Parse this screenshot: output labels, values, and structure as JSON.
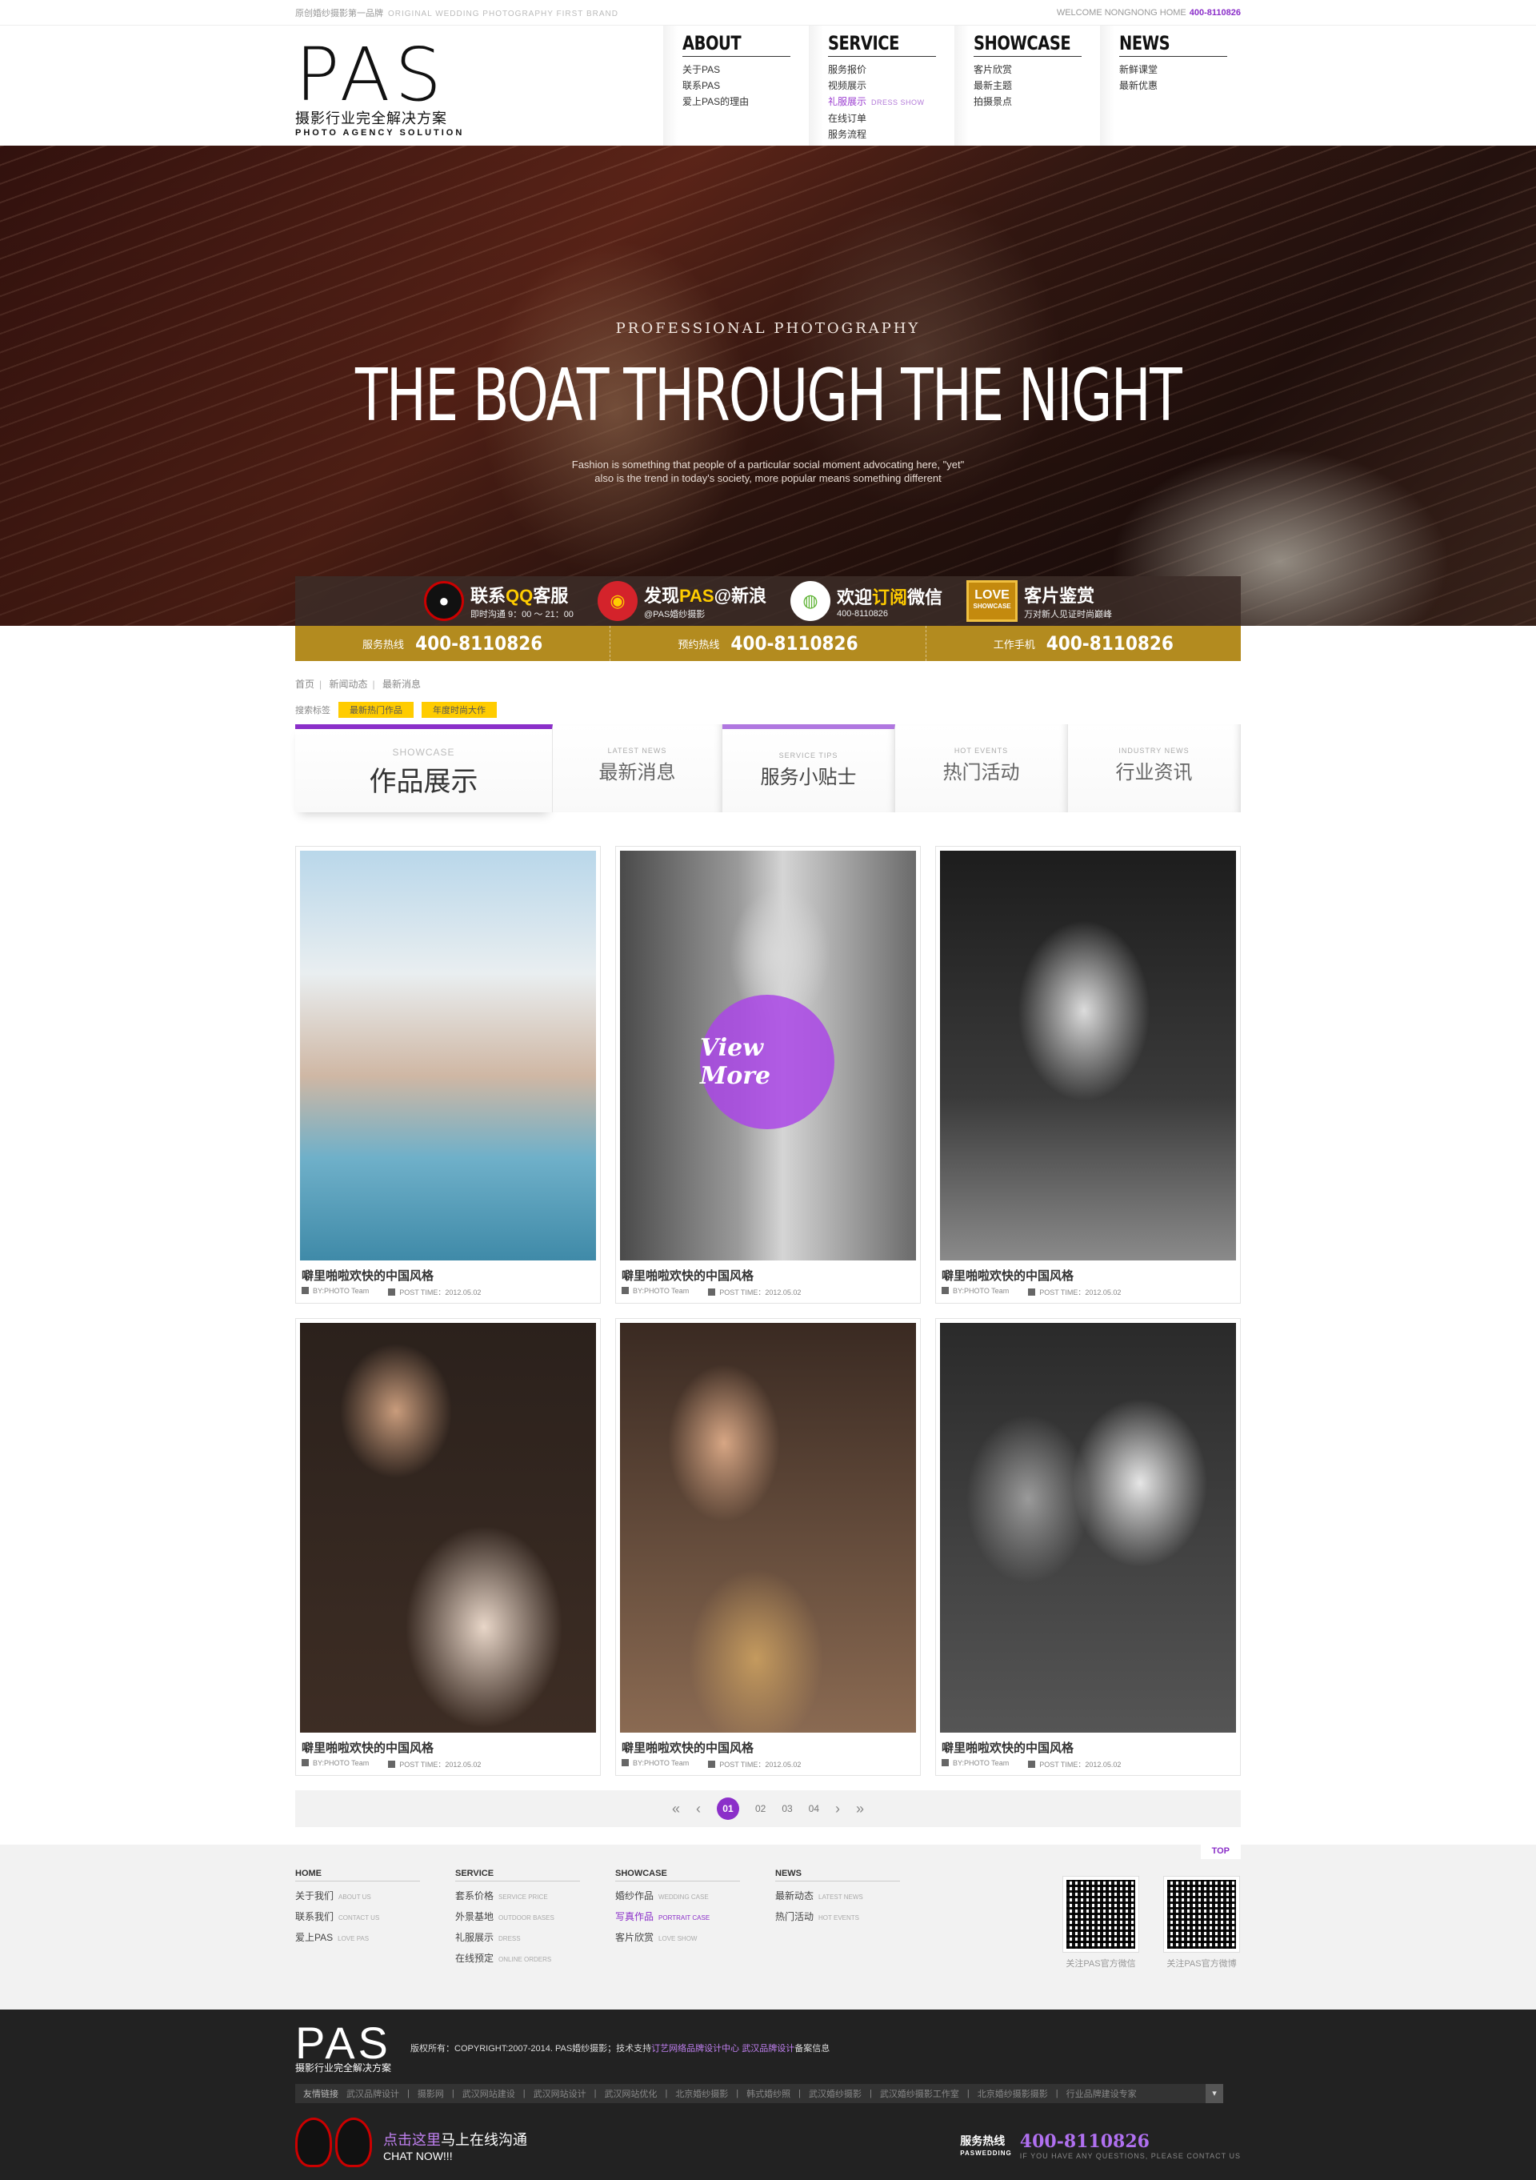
{
  "topbar": {
    "left_cn": "原创婚纱摄影第一品牌",
    "left_en": "ORIGINAL WEDDING PHOTOGRAPHY FIRST BRAND",
    "welcome": "WELCOME NONGNONG HOME",
    "phone": "400-8110826"
  },
  "logo": {
    "name": "PAS",
    "cn": "摄影行业完全解决方案",
    "en": "PHOTO AGENCY SOLUTION"
  },
  "nav": [
    {
      "title": "ABOUT",
      "items": [
        "关于PAS",
        "联系PAS",
        "爱上PAS的理由"
      ]
    },
    {
      "title": "SERVICE",
      "items": [
        "服务报价",
        "视频展示",
        "礼服展示",
        "在线订单",
        "服务流程"
      ],
      "active_en": "DRESS SHOW"
    },
    {
      "title": "SHOWCASE",
      "items": [
        "客片欣赏",
        "最新主题",
        "拍摄景点"
      ]
    },
    {
      "title": "NEWS",
      "items": [
        "新鲜课堂",
        "最新优惠"
      ]
    }
  ],
  "hero": {
    "subtitle": "PROFESSIONAL PHOTOGRAPHY",
    "title": "THE BOAT THROUGH THE NIGHT",
    "desc1": "Fashion is something that people of a particular social moment advocating here, \"yet\"",
    "desc2": "also is the trend in today's society, more popular means something different"
  },
  "services": [
    {
      "title_a": "联系",
      "title_b": "QQ",
      "title_c": "客服",
      "sub": "即时沟通 9：00 ～ 21：00"
    },
    {
      "title_a": "发现",
      "title_b": "PAS",
      "title_c": "@新浪",
      "sub": "@PAS婚纱摄影"
    },
    {
      "title_a": "欢迎",
      "title_b": "订阅",
      "title_c": "微信",
      "sub": "400-8110826"
    },
    {
      "badge": "LOVE",
      "badge_sub": "SHOWCASE",
      "title_a": "客片鉴赏",
      "sub": "万对新人见证时尚巅峰"
    }
  ],
  "hotlines": [
    {
      "label": "服务热线",
      "number": "400-8110826"
    },
    {
      "label": "预约热线",
      "number": "400-8110826"
    },
    {
      "label": "工作手机",
      "number": "400-8110826"
    }
  ],
  "breadcrumb": [
    "首页",
    "新闻动态",
    "最新消息"
  ],
  "search_tags": {
    "label": "搜索标签",
    "tags": [
      "最新热门作品",
      "年度时尚大作"
    ]
  },
  "tabs": [
    {
      "en": "SHOWCASE",
      "cn": "作品展示"
    },
    {
      "en": "LATEST NEWS",
      "cn": "最新消息"
    },
    {
      "en": "SERVICE TIPS",
      "cn": "服务小贴士"
    },
    {
      "en": "HOT EVENTS",
      "cn": "热门活动"
    },
    {
      "en": "INDUSTRY NEWS",
      "cn": "行业资讯"
    }
  ],
  "cards": [
    {
      "title": "噼里啪啦欢快的中国风格",
      "by": "BY:PHOTO Team",
      "time": "POST TIME：2012.05.02"
    },
    {
      "title": "噼里啪啦欢快的中国风格",
      "by": "BY:PHOTO Team",
      "time": "POST TIME：2012.05.02",
      "overlay": "View More"
    },
    {
      "title": "噼里啪啦欢快的中国风格",
      "by": "BY:PHOTO Team",
      "time": "POST TIME：2012.05.02"
    },
    {
      "title": "噼里啪啦欢快的中国风格",
      "by": "BY:PHOTO Team",
      "time": "POST TIME：2012.05.02"
    },
    {
      "title": "噼里啪啦欢快的中国风格",
      "by": "BY:PHOTO Team",
      "time": "POST TIME：2012.05.02"
    },
    {
      "title": "噼里啪啦欢快的中国风格",
      "by": "BY:PHOTO Team",
      "time": "POST TIME：2012.05.02"
    }
  ],
  "pager": {
    "current": "01",
    "pages": [
      "02",
      "03",
      "04"
    ]
  },
  "footer_nav": [
    {
      "title": "HOME",
      "items": [
        [
          "关于我们",
          "ABOUT US"
        ],
        [
          "联系我们",
          "CONTACT US"
        ],
        [
          "爱上PAS",
          "LOVE PAS"
        ]
      ]
    },
    {
      "title": "SERVICE",
      "items": [
        [
          "套系价格",
          "SERVICE PRICE"
        ],
        [
          "外景基地",
          "OUTDOOR BASES"
        ],
        [
          "礼服展示",
          "DRESS"
        ],
        [
          "在线预定",
          "ONLINE ORDERS"
        ]
      ]
    },
    {
      "title": "SHOWCASE",
      "items": [
        [
          "婚纱作品",
          "WEDDING CASE"
        ],
        [
          "写真作品",
          "PORTRAIT CASE"
        ],
        [
          "客片欣赏",
          "LOVE SHOW"
        ]
      ]
    },
    {
      "title": "NEWS",
      "items": [
        [
          "最新动态",
          "LATEST NEWS"
        ],
        [
          "热门活动",
          "HOT EVENTS"
        ]
      ]
    }
  ],
  "top_label": "TOP",
  "qr": [
    "关注PAS官方微信",
    "关注PAS官方微博"
  ],
  "copyright": {
    "a": "版权所有：COPYRIGHT:2007-2014. PAS婚纱摄影；技术支持",
    "b": "订艺网络品牌设计中心",
    "c": "武汉品牌设计",
    "d": "备案信息"
  },
  "friend_links": {
    "label": "友情链接",
    "items": [
      "武汉品牌设计",
      "摄影网",
      "武汉网站建设",
      "武汉网站设计",
      "武汉网站优化",
      "北京婚纱摄影",
      "韩式婚纱照",
      "武汉婚纱摄影",
      "武汉婚纱摄影工作室",
      "北京婚纱摄影摄影",
      "行业品牌建设专家"
    ]
  },
  "chat": {
    "a": "点击这里",
    "b": "马上在线沟通",
    "c": "CHAT NOW!!!"
  },
  "service_line": {
    "label": "服务热线",
    "label_en": "PASWEDDING",
    "number": "400-8110826",
    "note": "IF YOU HAVE ANY QUESTIONS, PLEASE CONTACT US"
  }
}
